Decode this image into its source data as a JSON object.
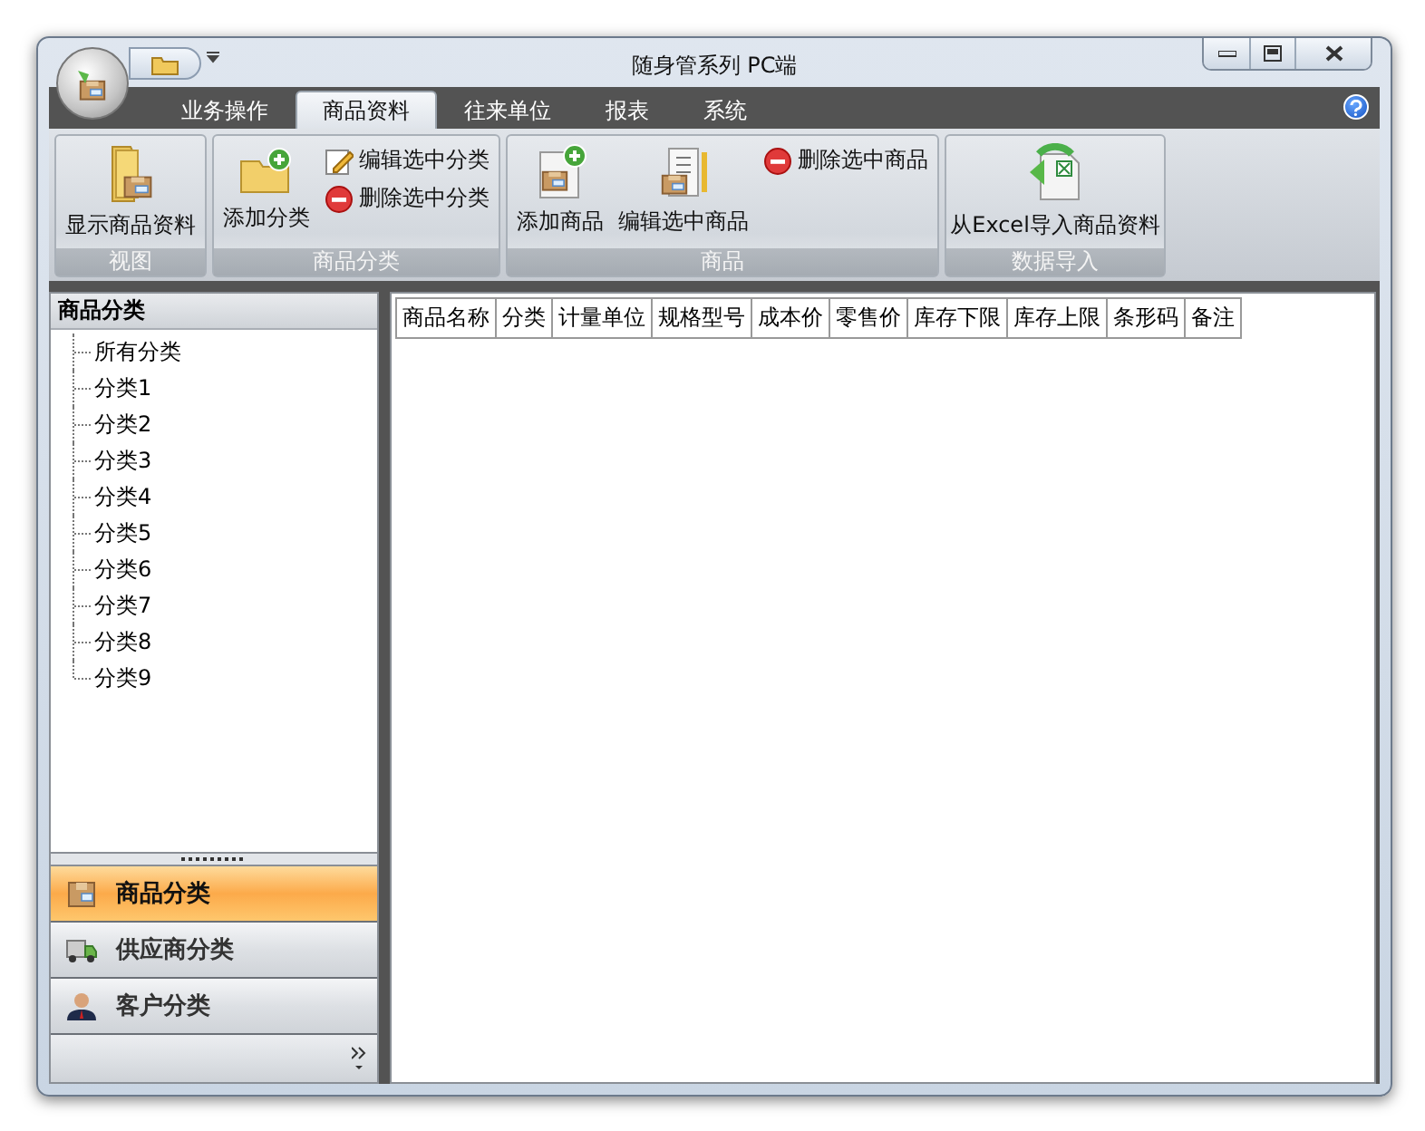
{
  "window": {
    "title": "随身管系列 PC端"
  },
  "tabs": [
    {
      "label": "业务操作",
      "selected": false
    },
    {
      "label": "商品资料",
      "selected": true
    },
    {
      "label": "往来单位",
      "selected": false
    },
    {
      "label": "报表",
      "selected": false
    },
    {
      "label": "系统",
      "selected": false
    }
  ],
  "ribbon_groups": [
    {
      "label": "视图",
      "items": [
        {
          "kind": "large",
          "label": "显示商品资料"
        }
      ]
    },
    {
      "label": "商品分类",
      "items": [
        {
          "kind": "large",
          "label": "添加分类"
        },
        {
          "kind": "small",
          "label": "编辑选中分类"
        },
        {
          "kind": "small",
          "label": "删除选中分类"
        }
      ]
    },
    {
      "label": "商品",
      "items": [
        {
          "kind": "large",
          "label": "添加商品"
        },
        {
          "kind": "large",
          "label": "编辑选中商品"
        },
        {
          "kind": "small",
          "label": "删除选中商品"
        }
      ]
    },
    {
      "label": "数据导入",
      "items": [
        {
          "kind": "large",
          "label": "从Excel导入商品资料"
        }
      ]
    }
  ],
  "tree": {
    "title": "商品分类",
    "items": [
      "所有分类",
      "分类1",
      "分类2",
      "分类3",
      "分类4",
      "分类5",
      "分类6",
      "分类7",
      "分类8",
      "分类9"
    ]
  },
  "nav_items": [
    {
      "label": "商品分类",
      "selected": true
    },
    {
      "label": "供应商分类",
      "selected": false
    },
    {
      "label": "客户分类",
      "selected": false
    }
  ],
  "table": {
    "columns": [
      "商品名称",
      "分类",
      "计量单位",
      "规格型号",
      "成本价",
      "零售价",
      "库存下限",
      "库存上限",
      "条形码",
      "备注"
    ]
  }
}
